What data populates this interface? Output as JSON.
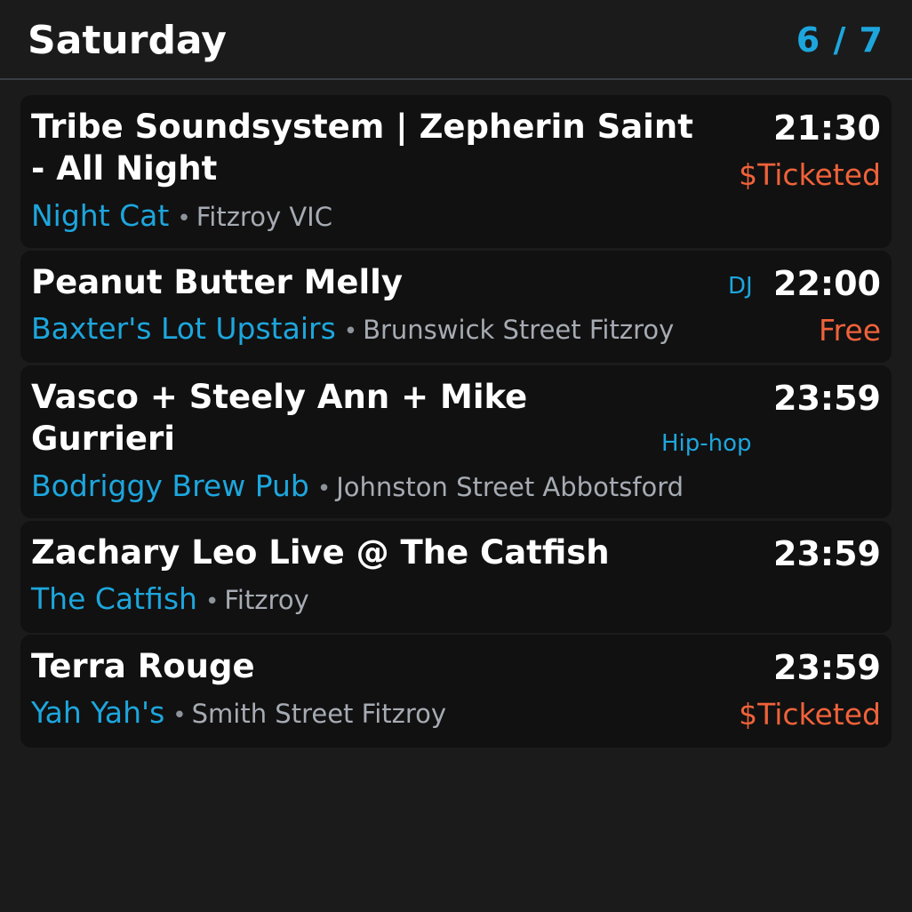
{
  "header": {
    "title": "Saturday",
    "page_indicator": "6 / 7"
  },
  "colors": {
    "background": "#1b1b1b",
    "card": "#111111",
    "accent": "#1da6dd",
    "price": "#f0623a",
    "text": "#ffffff",
    "muted": "#a6abb3"
  },
  "separator": "•",
  "events": [
    {
      "name": "Tribe Soundsystem | Zepherin Saint - All Night",
      "time": "21:30",
      "price": "$Ticketed",
      "genre": "",
      "venue": "Night Cat",
      "address": "Fitzroy VIC"
    },
    {
      "name": "Peanut Butter Melly",
      "time": "22:00",
      "price": "Free",
      "genre": "DJ",
      "venue": "Baxter's Lot Upstairs",
      "address": "Brunswick Street Fitzroy"
    },
    {
      "name": "Vasco + Steely Ann + Mike Gurrieri",
      "time": "23:59",
      "price": "",
      "genre": "Hip-hop",
      "venue": "Bodriggy Brew Pub",
      "address": "Johnston Street Abbotsford"
    },
    {
      "name": "Zachary Leo Live @ The Catfish",
      "time": "23:59",
      "price": "",
      "genre": "",
      "venue": "The Catfish",
      "address": "Fitzroy"
    },
    {
      "name": "Terra Rouge",
      "time": "23:59",
      "price": "$Ticketed",
      "genre": "",
      "venue": "Yah Yah's",
      "address": "Smith Street Fitzroy"
    }
  ]
}
